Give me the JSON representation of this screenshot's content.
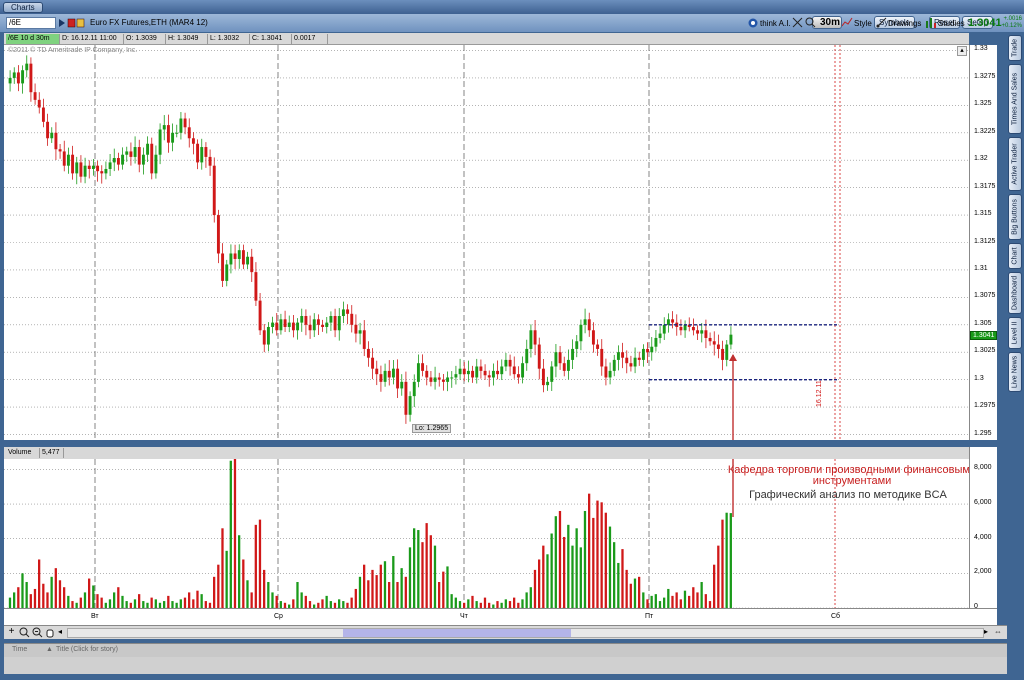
{
  "window": {
    "tab_label": "Charts"
  },
  "toolbar": {
    "symbol": "/6E",
    "description": "Euro FX Futures,ETH (MAR4 12)",
    "buttons": {
      "symbols": "Symbols",
      "reset": "Reset",
      "setup": "Setup"
    },
    "think_ai": "think A.I.",
    "timeframe": "30m",
    "style": "Style",
    "drawings": "Drawings",
    "studies": "Studies",
    "last_price": "1.3041",
    "change_lines": [
      "+.0016",
      "+0.12%"
    ]
  },
  "info_bar": {
    "chart_id": "/6E 10 d 30m",
    "date": "D: 16.12.11 11:00",
    "open": "O: 1.3039",
    "high": "H: 1.3049",
    "low": "L: 1.3032",
    "close": "C: 1.3041",
    "change": "0.0017"
  },
  "copyright": "©2011 © TD Ameritrade IP Company, Inc.",
  "price_badge": "1.3041",
  "lo_label": "Lo: 1.2965",
  "date_marker": "16.12.11",
  "annotation": {
    "line1": "Кафедра торговли производными финансовыми",
    "line2": "инструментами",
    "line3": "Графический анализ по методике BCA"
  },
  "volume_bar": {
    "label": "Volume",
    "value": "5,477"
  },
  "news": {
    "time_label": "Time",
    "title_label": "Title (Click for story)"
  },
  "side_tabs": [
    "Trade",
    "Times And Sales",
    "Active Trader",
    "Big Buttons",
    "Chart",
    "Dashboard",
    "Level II",
    "Live News"
  ],
  "colors": {
    "up": "#1a9a1a",
    "down": "#d01818",
    "dashed_line": "#1a237e",
    "date_marker": "#d01818",
    "accent": "#3f6592"
  },
  "chart_data": [
    {
      "type": "candlestick",
      "title": "",
      "y_ticks": [
        "1.33",
        "1.3275",
        "1.325",
        "1.3225",
        "1.32",
        "1.3175",
        "1.315",
        "1.3125",
        "1.31",
        "1.3075",
        "1.305",
        "1.3025",
        "1.3",
        "1.2975",
        "1.295"
      ],
      "ylim": [
        1.2945,
        1.3305
      ],
      "x_tick_labels": [
        "Вт",
        "Ср",
        "Чт",
        "Пт",
        "Сб"
      ],
      "lo": 1.2965,
      "horizontal_lines": [
        1.305,
        1.3
      ],
      "closes": [
        1.3275,
        1.328,
        1.327,
        1.3282,
        1.3288,
        1.3262,
        1.3255,
        1.3248,
        1.3235,
        1.322,
        1.3225,
        1.321,
        1.3208,
        1.3195,
        1.3205,
        1.3188,
        1.3198,
        1.3185,
        1.3195,
        1.3192,
        1.3195,
        1.319,
        1.3188,
        1.3192,
        1.3198,
        1.3202,
        1.3196,
        1.3205,
        1.3208,
        1.3203,
        1.3212,
        1.3196,
        1.3205,
        1.3215,
        1.3188,
        1.3205,
        1.3228,
        1.3232,
        1.3216,
        1.3225,
        1.3225,
        1.3238,
        1.323,
        1.322,
        1.3215,
        1.3198,
        1.3212,
        1.3203,
        1.3195,
        1.315,
        1.3115,
        1.309,
        1.3105,
        1.3115,
        1.311,
        1.3118,
        1.3105,
        1.3112,
        1.3098,
        1.3072,
        1.3045,
        1.3032,
        1.3048,
        1.3052,
        1.3045,
        1.3055,
        1.3048,
        1.3052,
        1.3045,
        1.3052,
        1.3058,
        1.305,
        1.3045,
        1.3055,
        1.305,
        1.3048,
        1.3052,
        1.3058,
        1.3045,
        1.3058,
        1.3064,
        1.306,
        1.305,
        1.3042,
        1.3045,
        1.3028,
        1.302,
        1.301,
        1.3005,
        1.2998,
        1.3008,
        1.3002,
        1.301,
        1.2992,
        1.2998,
        1.2968,
        1.2985,
        1.2998,
        1.3015,
        1.3008,
        1.3002,
        1.2998,
        1.3002,
        1.3,
        1.2998,
        1.3002,
        1.3002,
        1.3005,
        1.301,
        1.3005,
        1.3008,
        1.3002,
        1.3012,
        1.3008,
        1.3004,
        1.3002,
        1.3008,
        1.3005,
        1.3012,
        1.3018,
        1.3012,
        1.3005,
        1.3002,
        1.3015,
        1.3028,
        1.3045,
        1.3032,
        1.301,
        1.2995,
        1.2998,
        1.3012,
        1.3025,
        1.3015,
        1.3008,
        1.3018,
        1.3028,
        1.3035,
        1.305,
        1.3055,
        1.3045,
        1.3032,
        1.3028,
        1.3012,
        1.3002,
        1.3008,
        1.3018,
        1.3025,
        1.302,
        1.3015,
        1.3012,
        1.302,
        1.3018,
        1.3028,
        1.3025,
        1.303,
        1.3038,
        1.3042,
        1.305,
        1.3055,
        1.3052,
        1.3048,
        1.3045,
        1.305,
        1.3048,
        1.3045,
        1.3042,
        1.3045,
        1.3038,
        1.3035,
        1.3032,
        1.3028,
        1.3018,
        1.3032,
        1.3041
      ]
    },
    {
      "type": "bar",
      "title": "Volume",
      "y_ticks": [
        "8,000",
        "6,000",
        "4,000",
        "2,000",
        "0"
      ],
      "ylim": [
        0,
        8600
      ],
      "values": [
        600,
        900,
        1200,
        2000,
        1500,
        800,
        1100,
        2800,
        1400,
        900,
        1800,
        2300,
        1600,
        1200,
        700,
        400,
        300,
        600,
        900,
        1700,
        1300,
        800,
        600,
        300,
        500,
        900,
        1200,
        700,
        400,
        300,
        500,
        800,
        400,
        300,
        600,
        500,
        300,
        400,
        700,
        400,
        300,
        500,
        600,
        900,
        500,
        1000,
        800,
        400,
        300,
        1800,
        2500,
        4600,
        3300,
        8500,
        8600,
        4200,
        2800,
        1600,
        900,
        4800,
        5100,
        2200,
        1500,
        900,
        700,
        400,
        300,
        200,
        500,
        1500,
        900,
        700,
        400,
        200,
        300,
        500,
        700,
        400,
        300,
        500,
        400,
        300,
        600,
        1100,
        1800,
        2500,
        1600,
        2200,
        1900,
        2500,
        2700,
        1500,
        3000,
        1500,
        2300,
        1800,
        3500,
        4600,
        4500,
        3800,
        4900,
        4200,
        3600,
        1500,
        2100,
        2400,
        800,
        600,
        400,
        300,
        500,
        700,
        400,
        300,
        600,
        300,
        200,
        400,
        300,
        500,
        400,
        600,
        300,
        500,
        900,
        1200,
        2200,
        2800,
        3600,
        3100,
        4300,
        5300,
        5600,
        4100,
        4800,
        3600,
        4600,
        3500,
        5600,
        6600,
        5200,
        6200,
        6100,
        5500,
        4700,
        3800,
        2600,
        3400,
        2200,
        1400,
        1700,
        1800,
        900,
        500,
        700,
        800,
        400,
        600,
        1100,
        700,
        900,
        500,
        1000,
        700,
        1200,
        900,
        1500,
        800,
        400,
        2500,
        3600,
        5100,
        5500,
        5477
      ]
    }
  ]
}
